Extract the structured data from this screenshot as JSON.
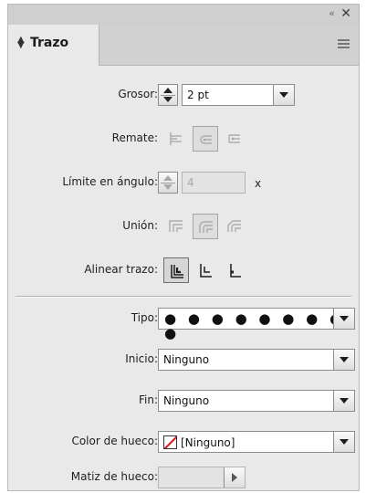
{
  "panel": {
    "tab_label": "Trazo",
    "collapse_label": "«",
    "close_label": "✕"
  },
  "stroke": {
    "grosor_label": "Grosor:",
    "grosor_value": "2 pt",
    "remate_label": "Remate:",
    "limite_label": "Límite en ángulo:",
    "limite_value": "4",
    "limite_unit": "x",
    "union_label": "Unión:",
    "alinear_label": "Alinear trazo:"
  },
  "type": {
    "tipo_label": "Tipo:",
    "tipo_value": "● ● ● ● ● ● ● ● ●",
    "inicio_label": "Inicio:",
    "inicio_value": "Ninguno",
    "fin_label": "Fin:",
    "fin_value": "Ninguno",
    "color_hueco_label": "Color de hueco:",
    "color_hueco_value": "[Ninguno]",
    "matiz_hueco_label": "Matiz de hueco:",
    "matiz_hueco_value": ""
  },
  "icons": {
    "remate": [
      "butt-cap-icon",
      "round-cap-icon",
      "projecting-cap-icon"
    ],
    "union": [
      "miter-join-icon",
      "round-join-icon",
      "bevel-join-icon"
    ],
    "alinear": [
      "align-center-icon",
      "align-inside-icon",
      "align-outside-icon"
    ]
  },
  "colors": {
    "panel_bg": "#e9e9e9",
    "tab_bar_bg": "#d1d1d1",
    "none_swatch_red": "#dd1111"
  }
}
